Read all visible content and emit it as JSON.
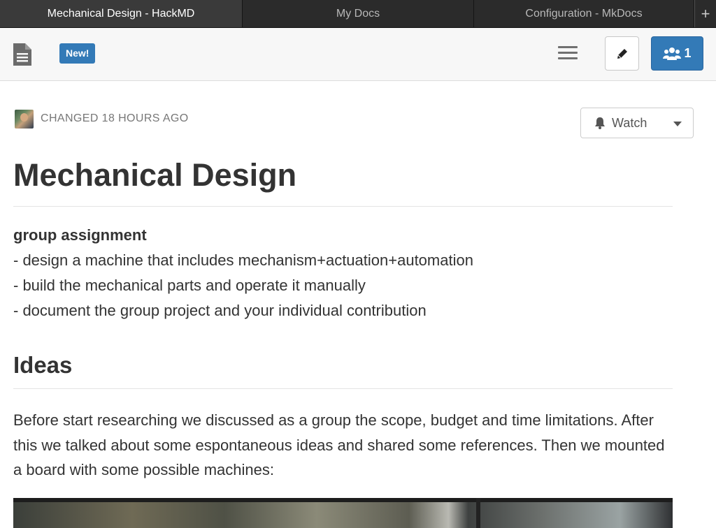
{
  "browser": {
    "tabs": [
      {
        "label": "Mechanical Design - HackMD",
        "active": true
      },
      {
        "label": "My Docs",
        "active": false
      },
      {
        "label": "Configuration - MkDocs",
        "active": false
      }
    ],
    "new_tab_symbol": "+"
  },
  "header": {
    "new_badge": "New!",
    "online_users_count": "1",
    "icons": [
      "document-icon",
      "hamburger-menu-icon",
      "pencil-icon",
      "users-icon"
    ]
  },
  "note": {
    "changed_text": "CHANGED 18 HOURS AGO",
    "watch_label": "Watch",
    "title": "Mechanical Design",
    "group_heading": "group assignment",
    "list": [
      "- design a machine that includes mechanism+actuation+automation",
      "- build the mechanical parts and operate it manually",
      "- document the group project and your individual contribution"
    ],
    "section_heading": "Ideas",
    "paragraph": "Before start researching we discussed as a group the scope, budget and time limitations. After this we talked about some espontaneous ideas and shared some references. Then we mounted a board with some possible machines:"
  },
  "colors": {
    "accent": "#337ab7",
    "tabbar": "#2b2b2b",
    "text": "#333333",
    "muted": "#777777"
  }
}
